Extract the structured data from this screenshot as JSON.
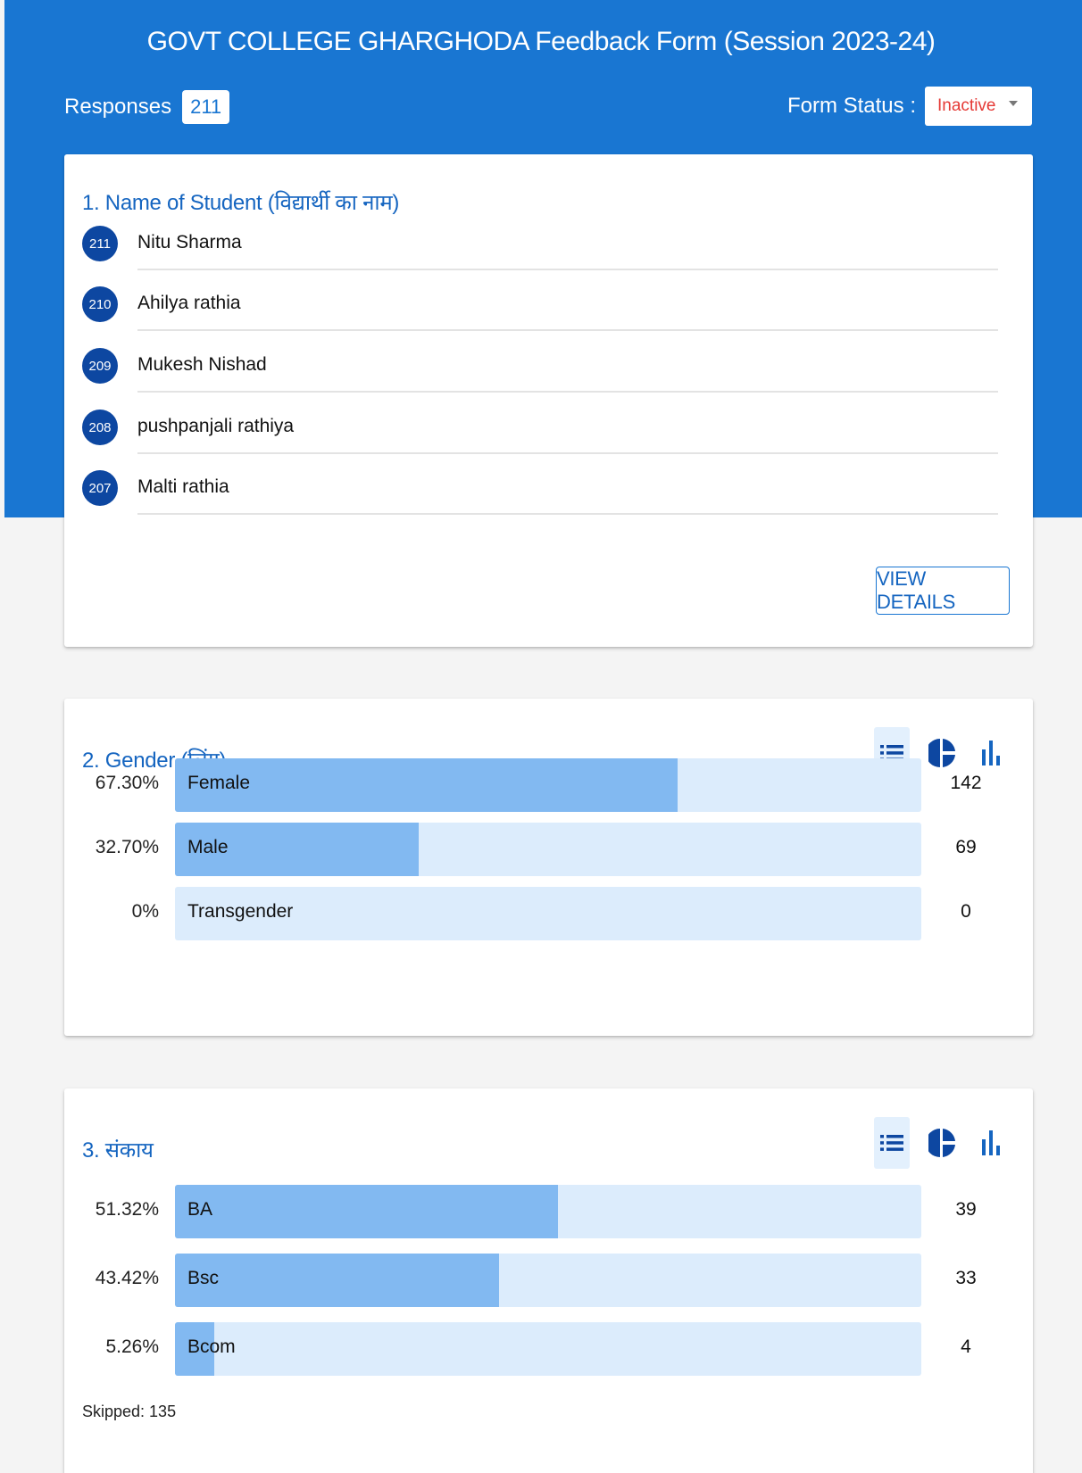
{
  "header": {
    "title": "GOVT COLLEGE GHARGHODA Feedback Form (Session 2023-24)",
    "responses_label": "Responses",
    "responses_count": "211",
    "form_status_label": "Form Status :",
    "form_status_value": "Inactive"
  },
  "colors": {
    "header_blue": "#1976d2",
    "badge_navy": "#0d47a1",
    "bar_fill": "#82b9f1",
    "bar_track": "#dcecfc",
    "inactive_red": "#e53935"
  },
  "q1": {
    "title": "1. Name of Student (विद्यार्थी का नाम)",
    "students": [
      {
        "num": "211",
        "name": "Nitu Sharma"
      },
      {
        "num": "210",
        "name": "Ahilya rathia"
      },
      {
        "num": "209",
        "name": "Mukesh Nishad"
      },
      {
        "num": "208",
        "name": "pushpanjali rathiya"
      },
      {
        "num": "207",
        "name": "Malti rathia"
      }
    ],
    "view_details_label": "VIEW DETAILS"
  },
  "q2": {
    "title": "2. Gender (लिंग)",
    "options": [
      {
        "pct": "67.30%",
        "label": "Female",
        "count": "142",
        "fraction": 0.673
      },
      {
        "pct": "32.70%",
        "label": "Male",
        "count": "69",
        "fraction": 0.327
      },
      {
        "pct": "0%",
        "label": "Transgender",
        "count": "0",
        "fraction": 0
      }
    ]
  },
  "q3": {
    "title": "3. संकाय",
    "options": [
      {
        "pct": "51.32%",
        "label": "BA",
        "count": "39",
        "fraction": 0.5132
      },
      {
        "pct": "43.42%",
        "label": "Bsc",
        "count": "33",
        "fraction": 0.4342
      },
      {
        "pct": "5.26%",
        "label": "Bcom",
        "count": "4",
        "fraction": 0.0526
      }
    ],
    "skipped": "Skipped: 135"
  },
  "icons": {
    "list_view": "list-view-icon",
    "pie_view": "pie-chart-icon",
    "bar_view": "bar-chart-icon",
    "status_dropdown": "chevron-down-icon"
  }
}
